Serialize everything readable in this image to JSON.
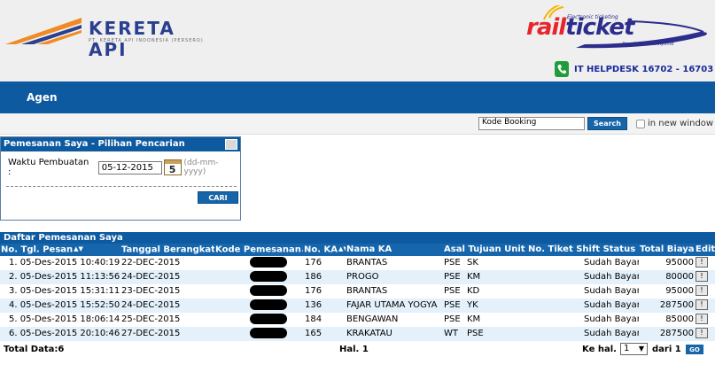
{
  "header": {
    "brand_title": "KERETA API",
    "brand_subtitle": "PT. KERETA API INDONESIA (PERSERO)",
    "railticket_rail": "rail",
    "railticket_ticket": "ticket",
    "railticket_tagline": "Electronic ticketing",
    "railticket_slogan": "Anywhere and Anytime",
    "helpdesk": "IT HELPDESK 16702 - 16703"
  },
  "nav": {
    "agen": "Agen"
  },
  "search": {
    "input_value": "Kode Booking",
    "button": "Search",
    "new_window_label": "in new window"
  },
  "filter": {
    "title": "Pemesanan Saya - Pilihan Pencarian",
    "waktu_label": "Waktu Pembuatan :",
    "date_value": "05-12-2015",
    "calendar_day": "5",
    "date_hint": "(dd-mm-yyyy)",
    "cari_button": "CARI"
  },
  "results": {
    "title": "Daftar Pemesanan Saya",
    "columns": [
      "No. Tgl. Pesan",
      "Tanggal Berangkat",
      "Kode Pemesanan",
      "No. KA",
      "Nama KA",
      "Asal Tujuan Unit No. Tiket Shift Status",
      "Total Biaya",
      "Edit"
    ],
    "rows": [
      {
        "no": "1.",
        "tgl_pesan": "05-Des-2015 10:40:19",
        "berangkat": "22-DEC-2015",
        "no_ka": "176",
        "nama_ka": "BRANTAS",
        "asal": "PSE",
        "tujuan": "SK",
        "status": "Sudah Bayar",
        "total": "95000",
        "edit": "!"
      },
      {
        "no": "2.",
        "tgl_pesan": "05-Des-2015 11:13:56",
        "berangkat": "24-DEC-2015",
        "no_ka": "186",
        "nama_ka": "PROGO",
        "asal": "PSE",
        "tujuan": "KM",
        "status": "Sudah Bayar",
        "total": "80000",
        "edit": "!"
      },
      {
        "no": "3.",
        "tgl_pesan": "05-Des-2015 15:31:11",
        "berangkat": "23-DEC-2015",
        "no_ka": "176",
        "nama_ka": "BRANTAS",
        "asal": "PSE",
        "tujuan": "KD",
        "status": "Sudah Bayar",
        "total": "95000",
        "edit": "!"
      },
      {
        "no": "4.",
        "tgl_pesan": "05-Des-2015 15:52:50",
        "berangkat": "24-DEC-2015",
        "no_ka": "136",
        "nama_ka": "FAJAR UTAMA YOGYA",
        "asal": "PSE",
        "tujuan": "YK",
        "status": "Sudah Bayar",
        "total": "287500",
        "edit": "!"
      },
      {
        "no": "5.",
        "tgl_pesan": "05-Des-2015 18:06:14",
        "berangkat": "25-DEC-2015",
        "no_ka": "184",
        "nama_ka": "BENGAWAN",
        "asal": "PSE",
        "tujuan": "KM",
        "status": "Sudah Bayar",
        "total": "85000",
        "edit": "!"
      },
      {
        "no": "6.",
        "tgl_pesan": "05-Des-2015 20:10:46",
        "berangkat": "27-DEC-2015",
        "no_ka": "165",
        "nama_ka": "KRAKATAU",
        "asal": "WT",
        "tujuan": "PSE",
        "status": "Sudah Bayar",
        "total": "287500",
        "edit": "!"
      }
    ]
  },
  "footer": {
    "total_data": "Total Data:6",
    "hal": "Hal. 1",
    "ke_hal": "Ke hal.",
    "page_value": "1",
    "dari": "dari 1",
    "go": "GO"
  },
  "colors": {
    "nav_blue": "#0e5aa0",
    "header_bg": "#efefef",
    "row_alt": "#e4f1fb",
    "brand_navy": "#2a3f8f",
    "railticket_red": "#e8252b"
  },
  "icons": [
    "kereta-api-logo-icon",
    "railticket-swoosh-icon",
    "phone-icon",
    "calendar-icon",
    "sort-arrows-icon",
    "chevron-down-icon"
  ]
}
